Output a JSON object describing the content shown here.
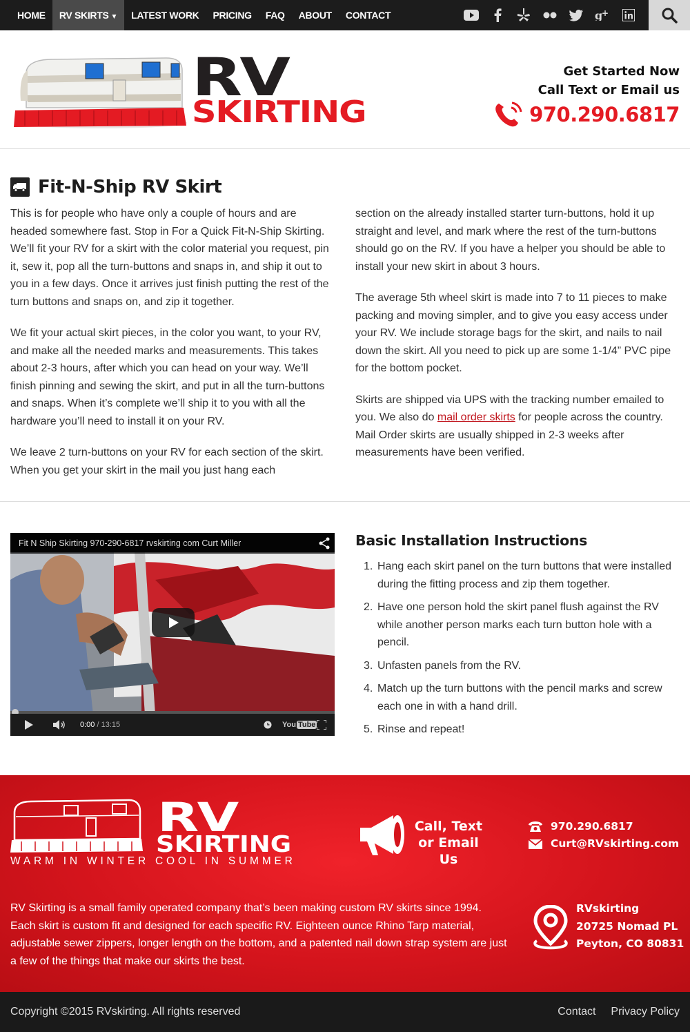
{
  "nav": {
    "items": [
      {
        "label": "HOME"
      },
      {
        "label": "RV SKIRTS"
      },
      {
        "label": "LATEST WORK"
      },
      {
        "label": "PRICING"
      },
      {
        "label": "FAQ"
      },
      {
        "label": "ABOUT"
      },
      {
        "label": "CONTACT"
      }
    ],
    "active_index": 1,
    "social_icons": [
      "youtube-icon",
      "facebook-icon",
      "yelp-icon",
      "flickr-icon",
      "twitter-icon",
      "google-plus-icon",
      "linkedin-icon"
    ],
    "search_icon": "search-icon"
  },
  "header": {
    "logo_rv": "RV",
    "logo_skirting": "SKIRTING",
    "cta_line1": "Get Started Now",
    "cta_line2": "Call Text or Email us",
    "phone": "970.290.6817"
  },
  "main": {
    "title": "Fit-N-Ship RV Skirt",
    "left_paragraphs": [
      "This is for people who have only a couple of hours and are headed somewhere fast. Stop in For a Quick Fit-N-Ship Skirting. We’ll fit your RV for a skirt with the color material you request, pin it, sew it, pop all the turn-buttons and snaps in, and ship it out to you in a few days. Once it arrives just finish putting the rest of the turn buttons and snaps on, and zip it together.",
      "We fit your actual skirt pieces, in the color you want, to your RV, and make all the needed marks and measurements. This takes about 2-3 hours, after which you can head on your way. We’ll finish pinning and sewing the skirt, and put in all the turn-buttons and snaps. When it’s complete we’ll ship it to you with all the hardware you’ll need to install it on your RV.",
      "We leave 2 turn-buttons on your RV for each section of the skirt. When you get your skirt in the mail you just hang each"
    ],
    "right_paragraphs": [
      "section on the already installed starter turn-buttons, hold it up straight and level, and mark where the rest of the turn-buttons should go on the RV. If you have a helper you should be able to install your new skirt in about 3 hours.",
      "The average 5th wheel skirt is made into 7 to 11 pieces to make packing and moving simpler, and to give you easy access under your RV. We include storage bags for the skirt, and nails to nail down the skirt. All you need to pick up are some 1-1/4” PVC pipe for the bottom pocket."
    ],
    "shipping_para": {
      "before": "Skirts are shipped via UPS with the tracking number emailed to you. We also do ",
      "link": "mail order skirts",
      "after": " for people across the country. Mail Order skirts are usually shipped in 2-3 weeks after measurements have been verified."
    }
  },
  "video": {
    "title": "Fit N Ship Skirting 970-290-6817 rvskirting com Curt Miller",
    "time_current": "0:00",
    "time_sep": " / ",
    "time_total": "13:15",
    "progress": 0,
    "youtube_text": "You",
    "youtube_badge": "Tube"
  },
  "instructions": {
    "title": "Basic Installation Instructions",
    "steps": [
      {
        "num": "1.",
        "text": "Hang each skirt panel on the turn buttons that were installed during the fitting process and zip them together."
      },
      {
        "num": "2.",
        "text": "Have one person hold the skirt panel flush against the RV while another person marks each turn button hole with a pencil."
      },
      {
        "num": "3.",
        "text": "Unfasten panels from the RV."
      },
      {
        "num": "4.",
        "text": "Match up the turn buttons with the pencil marks and screw each one in with a hand drill."
      },
      {
        "num": "5.",
        "text": "Rinse and repeat!"
      }
    ]
  },
  "footer": {
    "logo_rv": "RV",
    "logo_skirting": "SKIRTING",
    "tagline": "WARM IN WINTER COOL IN SUMMER",
    "call_line1": "Call, Text",
    "call_line2": "or Email Us",
    "phone": "970.290.6817",
    "email": "Curt@RVskirting.com",
    "about": "RV Skirting is a small family operated company that’s been making custom RV skirts since 1994. Each skirt is custom fit and designed for each specific RV. Eighteen ounce Rhino Tarp material, adjustable sewer zippers, longer length on the bottom, and a patented nail down strap system are just a few of the things that make our skirts the best.",
    "address_name": "RVskirting",
    "address_street": "20725 Nomad PL",
    "address_city": "Peyton, CO 80831"
  },
  "bottom": {
    "copyright": "Copyright ©2015 RVskirting. All rights reserved",
    "links": [
      {
        "label": "Contact"
      },
      {
        "label": "Privacy Policy"
      }
    ]
  },
  "colors": {
    "brand_red": "#e41b23",
    "nav_bg": "#1c1c1c",
    "footer_bg": "#d4141c"
  }
}
